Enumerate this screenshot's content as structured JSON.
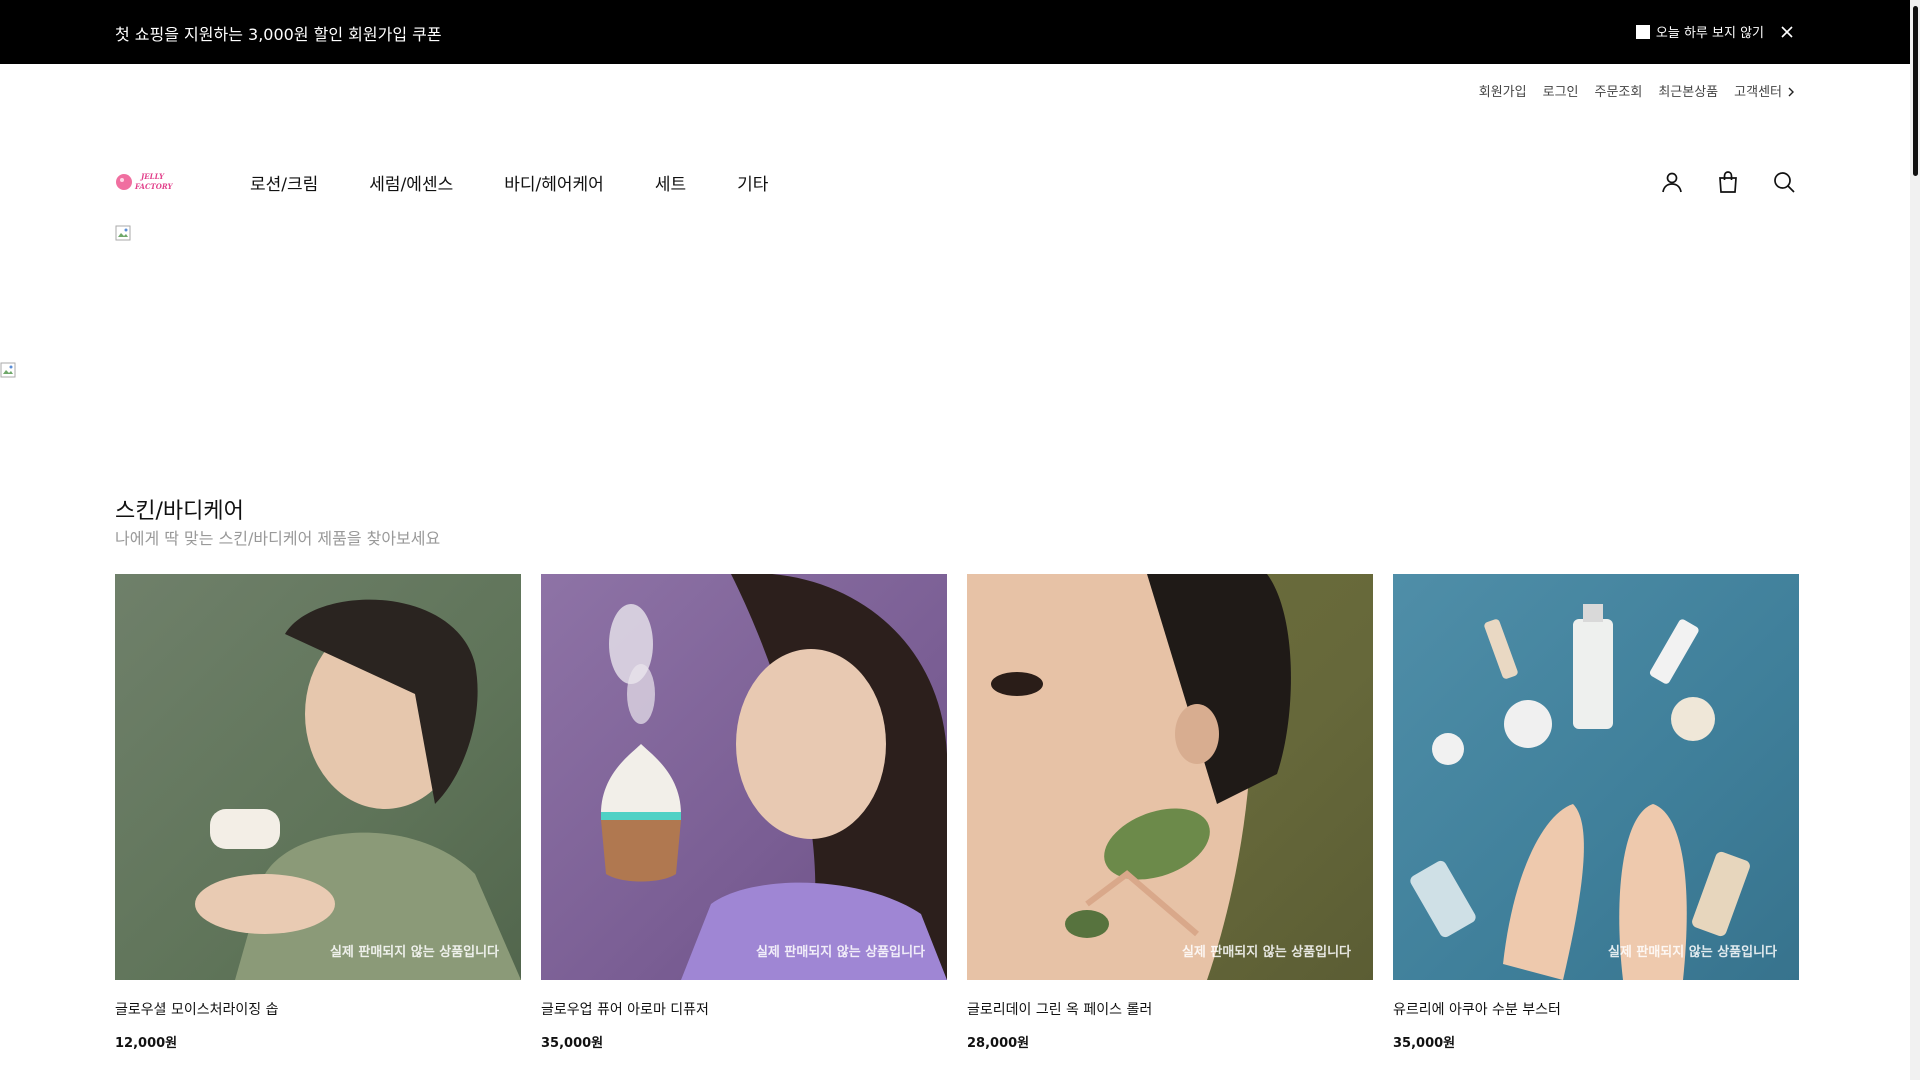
{
  "promo": {
    "text": "첫 쇼핑을 지원하는 3,000원 할인 회원가입 쿠폰",
    "hide_today": "오늘 하루 보지 않기"
  },
  "util_links": [
    "회원가입",
    "로그인",
    "주문조회",
    "최근본상품",
    "고객센터"
  ],
  "logo": {
    "line1": "JELLY",
    "line2": "FACTORY"
  },
  "gnb": [
    "로션/크림",
    "세럼/에센스",
    "바디/헤어케어",
    "세트",
    "기타"
  ],
  "section": {
    "title": "스킨/바디케어",
    "subtitle": "나에게 딱 맞는 스킨/바디케어 제품을 찾아보세요"
  },
  "products": [
    {
      "name": "글로우셜 모이스처라이징 솝",
      "price": "12,000원",
      "overlay": "실제 판매되지 않는 상품입니다"
    },
    {
      "name": "글로우업 퓨어 아로마 디퓨저",
      "price": "35,000원",
      "overlay": "실제 판매되지 않는 상품입니다"
    },
    {
      "name": "글로리데이 그린 옥 페이스 롤러",
      "price": "28,000원",
      "overlay": "실제 판매되지 않는 상품입니다"
    },
    {
      "name": "유르리에 아쿠아 수분 부스터",
      "price": "35,000원",
      "overlay": "실제 판매되지 않는 상품입니다"
    }
  ],
  "icons": {
    "user": "user-icon",
    "cart": "shopping-bag-icon",
    "search": "search-icon",
    "close": "close-icon"
  }
}
